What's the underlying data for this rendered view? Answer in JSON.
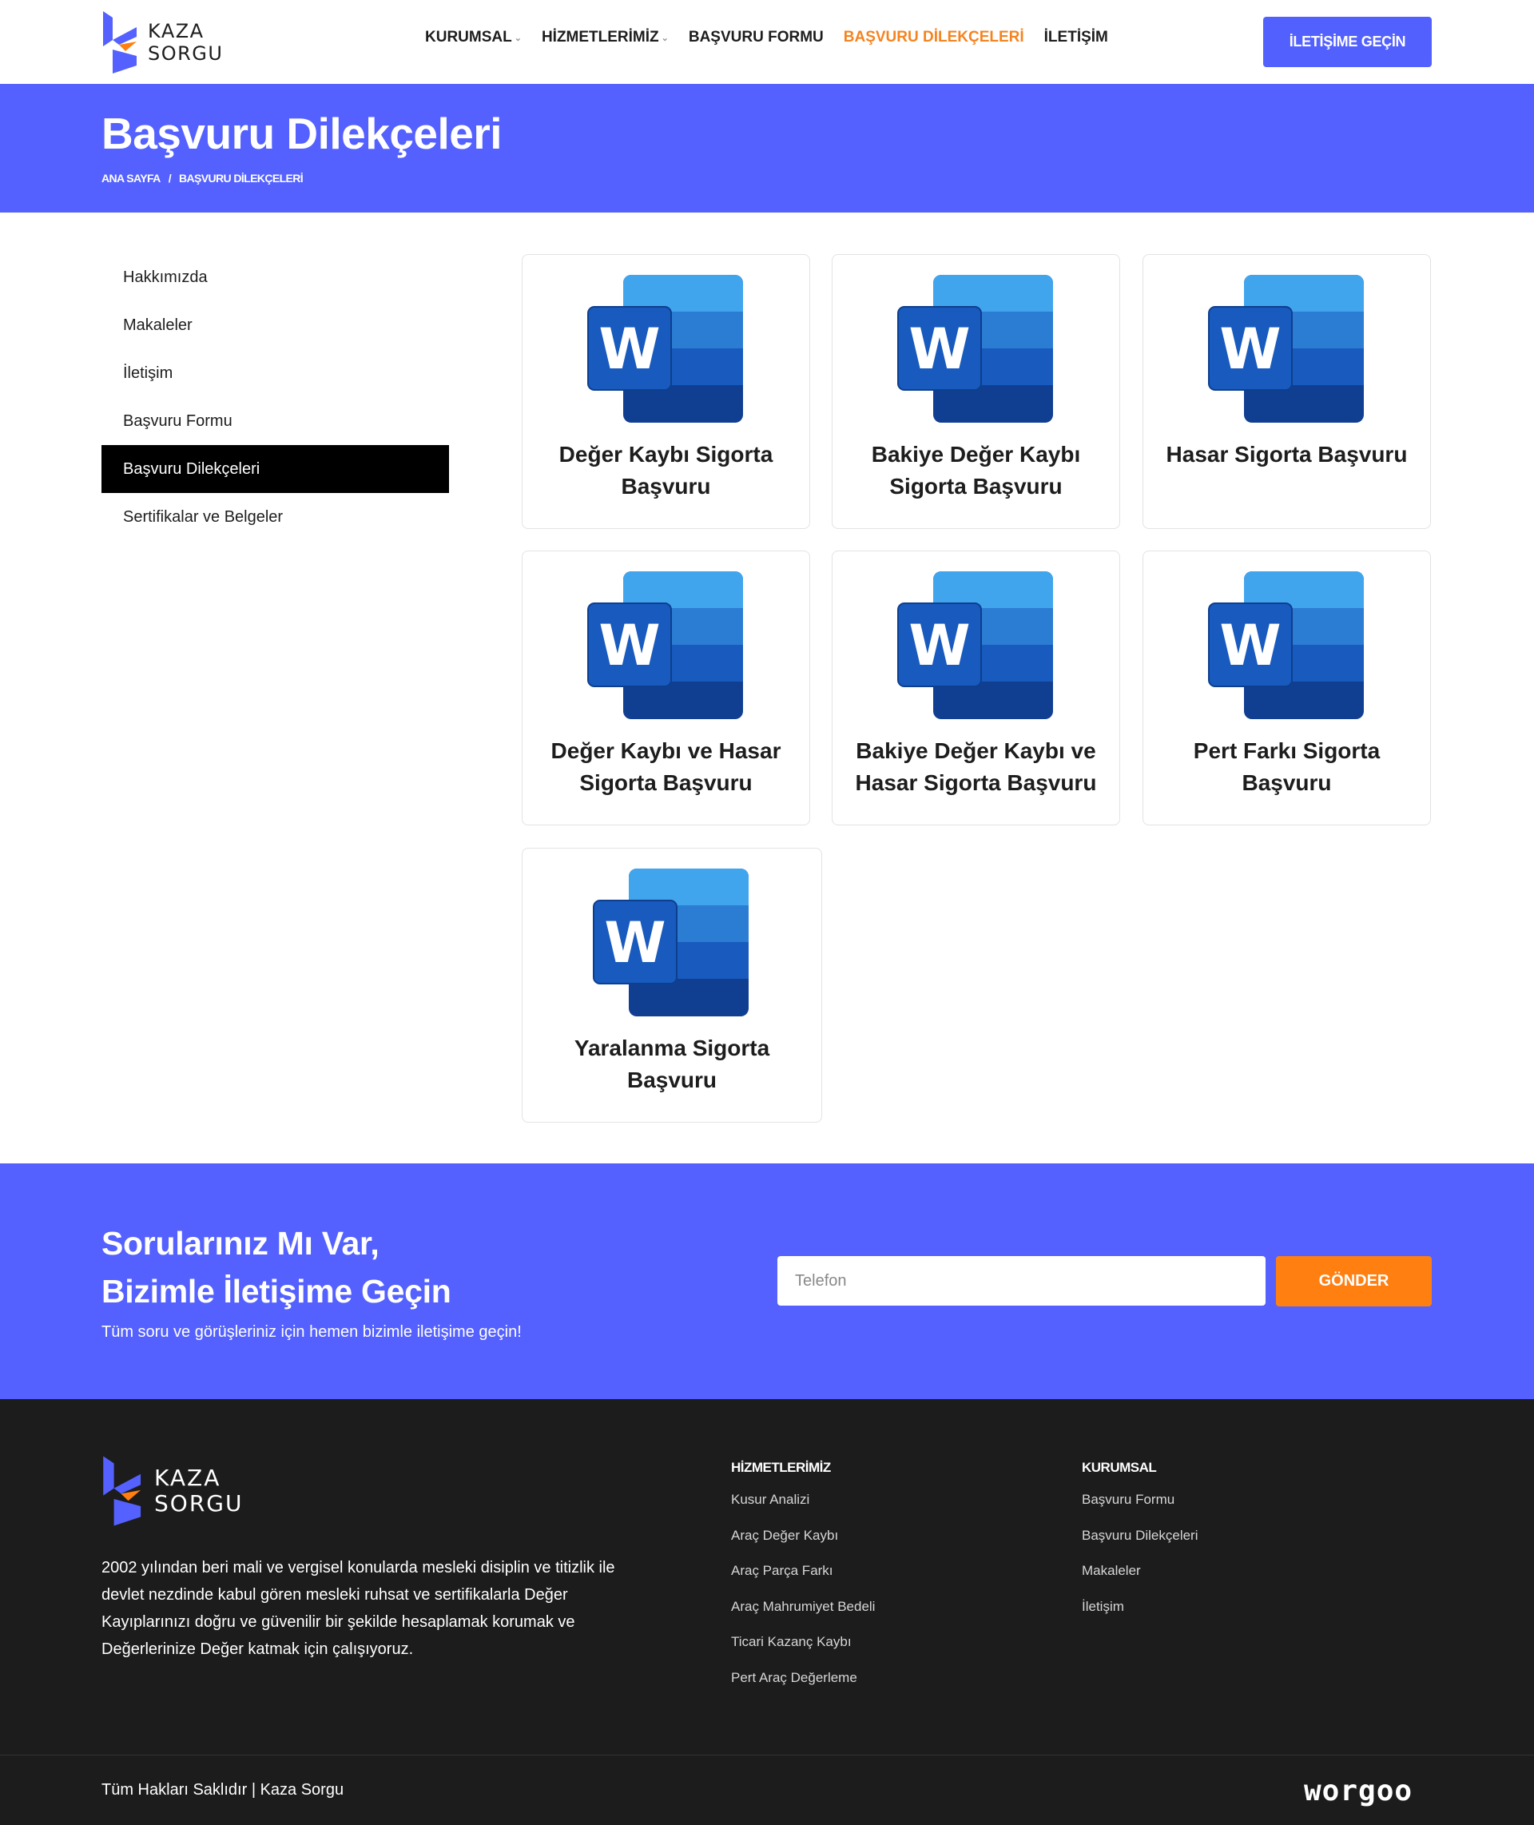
{
  "brand": {
    "line1": "KAZA",
    "line2": "SORGU"
  },
  "nav": {
    "items": [
      {
        "label": "KURUMSAL",
        "has_dropdown": true
      },
      {
        "label": "HİZMETLERİMİZ",
        "has_dropdown": true
      },
      {
        "label": "BAŞVURU FORMU",
        "has_dropdown": false
      },
      {
        "label": "BAŞVURU DİLEKÇELERİ",
        "has_dropdown": false,
        "active": true
      },
      {
        "label": "İLETİŞİM",
        "has_dropdown": false
      }
    ],
    "cta_label": "İLETİŞİME GEÇİN"
  },
  "page": {
    "title": "Başvuru Dilekçeleri",
    "breadcrumb": [
      "ANA SAYFA",
      "/",
      "BAŞVURU DİLEKÇELERİ"
    ]
  },
  "sidebar": {
    "items": [
      {
        "label": "Hakkımızda"
      },
      {
        "label": "Makaleler"
      },
      {
        "label": "İletişim"
      },
      {
        "label": "Başvuru Formu"
      },
      {
        "label": "Başvuru Dilekçeleri",
        "active": true
      },
      {
        "label": "Sertifikalar ve Belgeler"
      }
    ]
  },
  "documents": {
    "icon": "word-document-icon",
    "items": [
      {
        "title": "Değer Kaybı Sigorta Başvuru"
      },
      {
        "title": "Bakiye Değer Kaybı Sigorta Başvuru"
      },
      {
        "title": "Hasar Sigorta Başvuru"
      },
      {
        "title": "Değer Kaybı ve Hasar Sigorta Başvuru"
      },
      {
        "title": "Bakiye Değer Kaybı ve Hasar Sigorta Başvuru"
      },
      {
        "title": "Pert Farkı Sigorta Başvuru"
      },
      {
        "title": "Yaralanma Sigorta Başvuru"
      }
    ]
  },
  "contact": {
    "heading_line1": "Sorularınız Mı Var,",
    "heading_line2": "Bizimle İletişime Geçin",
    "subtitle": "Tüm soru ve görüşleriniz için hemen bizimle iletişime geçin!",
    "phone_placeholder": "Telefon",
    "send_label": "GÖNDER"
  },
  "footer": {
    "about": "2002 yılından beri mali ve vergisel konularda mesleki disiplin ve titizlik ile devlet nezdinde kabul gören mesleki ruhsat ve sertifikalarla Değer Kayıplarınızı doğru ve güvenilir bir şekilde hesaplamak korumak ve Değerlerinize Değer katmak için çalışıyoruz.",
    "services": {
      "heading": "HİZMETLERİMİZ",
      "links": [
        "Kusur Analizi",
        "Araç Değer Kaybı",
        "Araç Parça Farkı",
        "Araç Mahrumiyet Bedeli",
        "Ticari Kazanç Kaybı",
        "Pert Araç Değerleme"
      ]
    },
    "corporate": {
      "heading": "KURUMSAL",
      "links": [
        "Başvuru Formu",
        "Başvuru Dilekçeleri",
        "Makaleler",
        "İletişim"
      ]
    },
    "copyright": "Tüm Hakları Saklıdır | Kaza Sorgu",
    "developer": "worgoo"
  },
  "colors": {
    "primary": "#5461ff",
    "accent": "#ff7f11",
    "dark": "#1c1c1c"
  }
}
